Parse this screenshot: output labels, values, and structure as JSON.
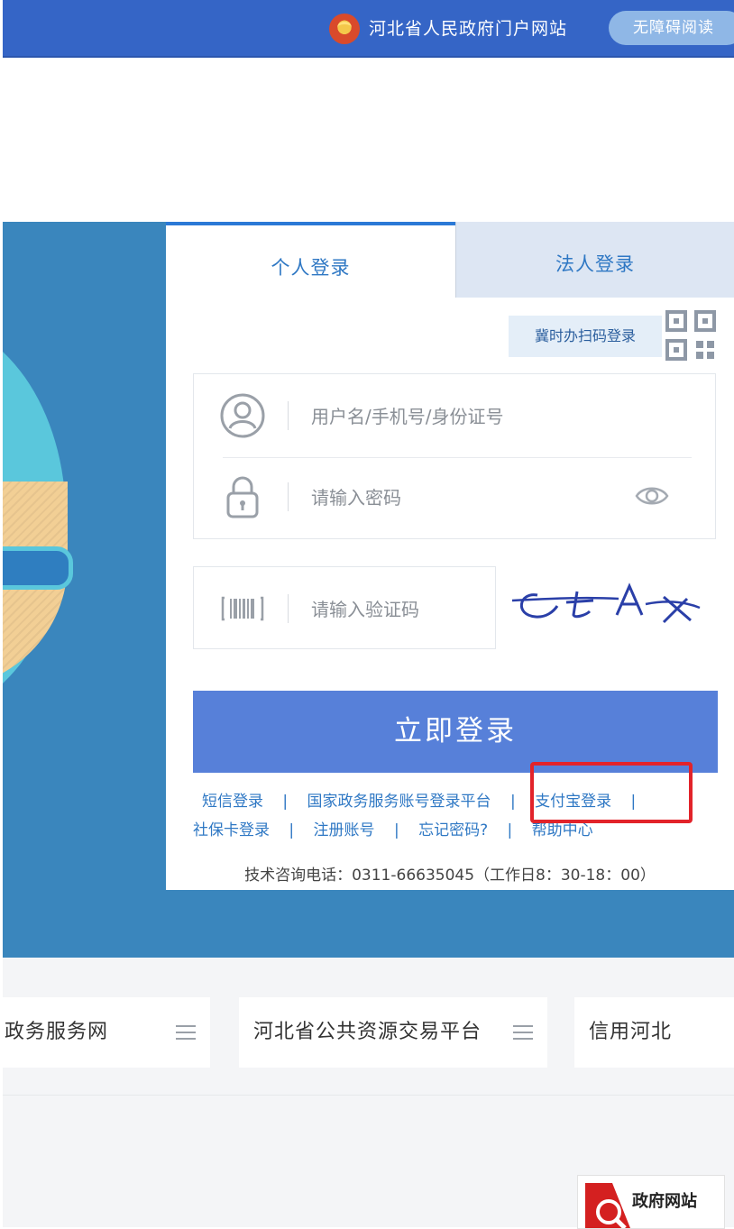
{
  "header": {
    "portal_label": "河北省人民政府门户网站",
    "accessibility_label": "无障碍阅读",
    "emblem_icon": "national-emblem-icon",
    "bar_color": "#3565c6"
  },
  "login": {
    "tabs": [
      {
        "label": "个人登录",
        "active": true
      },
      {
        "label": "法人登录",
        "active": false
      }
    ],
    "scan_login_label": "冀时办扫码登录",
    "username_placeholder": "用户名/手机号/身份证号",
    "password_placeholder": "请输入密码",
    "captcha_placeholder": "请输入验证码",
    "captcha_text": "ctAx",
    "submit_label": "立即登录",
    "links_row1": [
      "短信登录",
      "国家政务服务账号登录平台",
      "支付宝登录"
    ],
    "links_row2": [
      "社保卡登录",
      "注册账号",
      "忘记密码?",
      "帮助中心"
    ],
    "separator": "|",
    "hotline": "技术咨询电话：0311-66635045（工作日8：30-18：00）",
    "highlighted_link": "支付宝登录",
    "highlight_color": "#e2232a",
    "button_color": "#5780d9"
  },
  "platforms": [
    {
      "label": "政务服务网"
    },
    {
      "label": "河北省公共资源交易平台"
    },
    {
      "label": "信用河北"
    }
  ],
  "badge": {
    "label": "政府网站"
  }
}
